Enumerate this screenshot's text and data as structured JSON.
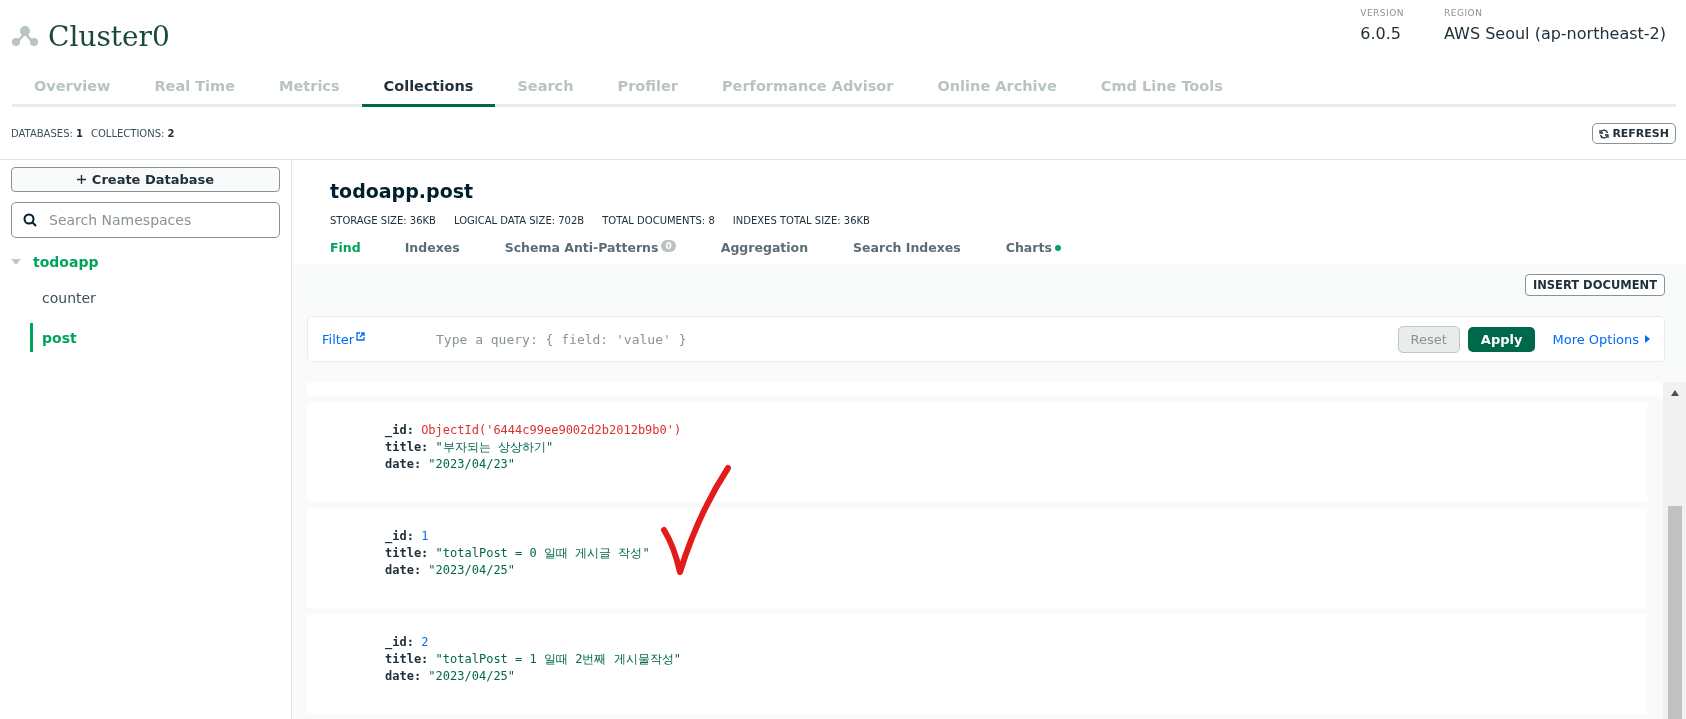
{
  "header": {
    "title": "Cluster0",
    "version_label": "VERSION",
    "version": "6.0.5",
    "region_label": "REGION",
    "region": "AWS Seoul (ap-northeast-2)"
  },
  "tabs": [
    {
      "label": "Overview",
      "selected": false
    },
    {
      "label": "Real Time",
      "selected": false
    },
    {
      "label": "Metrics",
      "selected": false
    },
    {
      "label": "Collections",
      "selected": true
    },
    {
      "label": "Search",
      "selected": false
    },
    {
      "label": "Profiler",
      "selected": false
    },
    {
      "label": "Performance Advisor",
      "selected": false
    },
    {
      "label": "Online Archive",
      "selected": false
    },
    {
      "label": "Cmd Line Tools",
      "selected": false
    }
  ],
  "summary": [
    {
      "label": "DATABASES:",
      "value": "1"
    },
    {
      "label": "COLLECTIONS:",
      "value": "2"
    }
  ],
  "refresh_button": "REFRESH",
  "sidebar": {
    "create_button": "Create Database",
    "search": {
      "placeholder": "Search Namespaces"
    },
    "databases": [
      {
        "label": "todoapp",
        "expanded": true,
        "children": [
          {
            "label": "counter",
            "selected": false
          },
          {
            "label": "post",
            "selected": true
          }
        ]
      }
    ]
  },
  "collection": {
    "title": "todoapp.post",
    "stats": [
      {
        "label": "STORAGE SIZE:",
        "value": "36KB"
      },
      {
        "label": "LOGICAL DATA SIZE:",
        "value": "702B"
      },
      {
        "label": "TOTAL DOCUMENTS:",
        "value": "8"
      },
      {
        "label": "INDEXES TOTAL SIZE:",
        "value": "36KB"
      }
    ],
    "tabs": [
      {
        "label": "Find",
        "selected": true
      },
      {
        "label": "Indexes",
        "selected": false
      },
      {
        "label": "Schema Anti-Patterns",
        "selected": false,
        "badge": "0"
      },
      {
        "label": "Aggregation",
        "selected": false
      },
      {
        "label": "Search Indexes",
        "selected": false
      },
      {
        "label": "Charts",
        "selected": false,
        "dot": true
      }
    ],
    "insert_button": "INSERT DOCUMENT",
    "filter": {
      "label": "Filter",
      "placeholder": "Type a query: { field: 'value' }",
      "reset": {
        "label": "Reset",
        "disabled": true
      },
      "apply": "Apply",
      "more": "More Options"
    },
    "documents": [
      {
        "fields": [
          {
            "key": "_id:",
            "value": "ObjectId('6444c99ee9002d2b2012b9b0')",
            "kind": "objectid"
          },
          {
            "key": "title:",
            "value": "\"부자되는 상상하기\"",
            "kind": "string"
          },
          {
            "key": "date:",
            "value": "\"2023/04/23\"",
            "kind": "string"
          }
        ]
      },
      {
        "fields": [
          {
            "key": "_id:",
            "value": "1",
            "kind": "number"
          },
          {
            "key": "title:",
            "value": "\"totalPost = 0 일때 게시글 작성\"",
            "kind": "string"
          },
          {
            "key": "date:",
            "value": "\"2023/04/25\"",
            "kind": "string"
          }
        ]
      },
      {
        "fields": [
          {
            "key": "_id:",
            "value": "2",
            "kind": "number"
          },
          {
            "key": "title:",
            "value": "\"totalPost = 1 일때 2번째 게시물작성\"",
            "kind": "string"
          },
          {
            "key": "date:",
            "value": "\"2023/04/25\"",
            "kind": "string"
          }
        ]
      }
    ]
  }
}
